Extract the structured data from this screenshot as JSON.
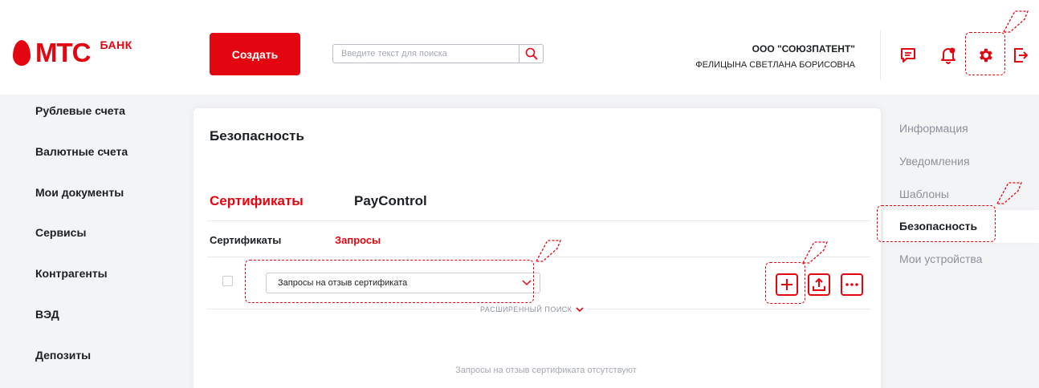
{
  "brand": {
    "logo_text": "МТС",
    "logo_sub": "БАНК",
    "accent": "#e30611"
  },
  "header": {
    "create_label": "Создать",
    "search_placeholder": "Введите текст для поиска",
    "org_name": "ООО \"СОЮЗПАТЕНТ\"",
    "user_name": "ФЕЛИЦЫНА СВЕТЛАНА БОРИСОВНА",
    "icons": [
      "chat-icon",
      "notification-icon",
      "gear-icon",
      "logout-icon"
    ]
  },
  "left_nav": {
    "items": [
      {
        "label": "Рублевые счета"
      },
      {
        "label": "Валютные счета"
      },
      {
        "label": "Мои документы"
      },
      {
        "label": "Сервисы"
      },
      {
        "label": "Контрагенты"
      },
      {
        "label": "ВЭД"
      },
      {
        "label": "Депозиты"
      }
    ]
  },
  "main": {
    "title": "Безопасность",
    "tabs": [
      {
        "label": "Сертификаты",
        "active": true
      },
      {
        "label": "PayControl",
        "active": false
      }
    ],
    "subtabs": [
      {
        "label": "Сертификаты",
        "active": false
      },
      {
        "label": "Запросы",
        "active": true
      }
    ],
    "filter_select": "Запросы на отзыв сертификата",
    "advanced_search": "РАСШИРЕННЫЙ ПОИСК",
    "empty_message": "Запросы на отзыв сертификата отсутствуют",
    "actions": [
      "plus-icon",
      "upload-icon",
      "more-icon"
    ]
  },
  "right_nav": {
    "items": [
      {
        "label": "Информация",
        "active": false
      },
      {
        "label": "Уведомления",
        "active": false
      },
      {
        "label": "Шаблоны",
        "active": false
      },
      {
        "label": "Безопасность",
        "active": true
      },
      {
        "label": "Мои устройства",
        "active": false
      }
    ]
  }
}
